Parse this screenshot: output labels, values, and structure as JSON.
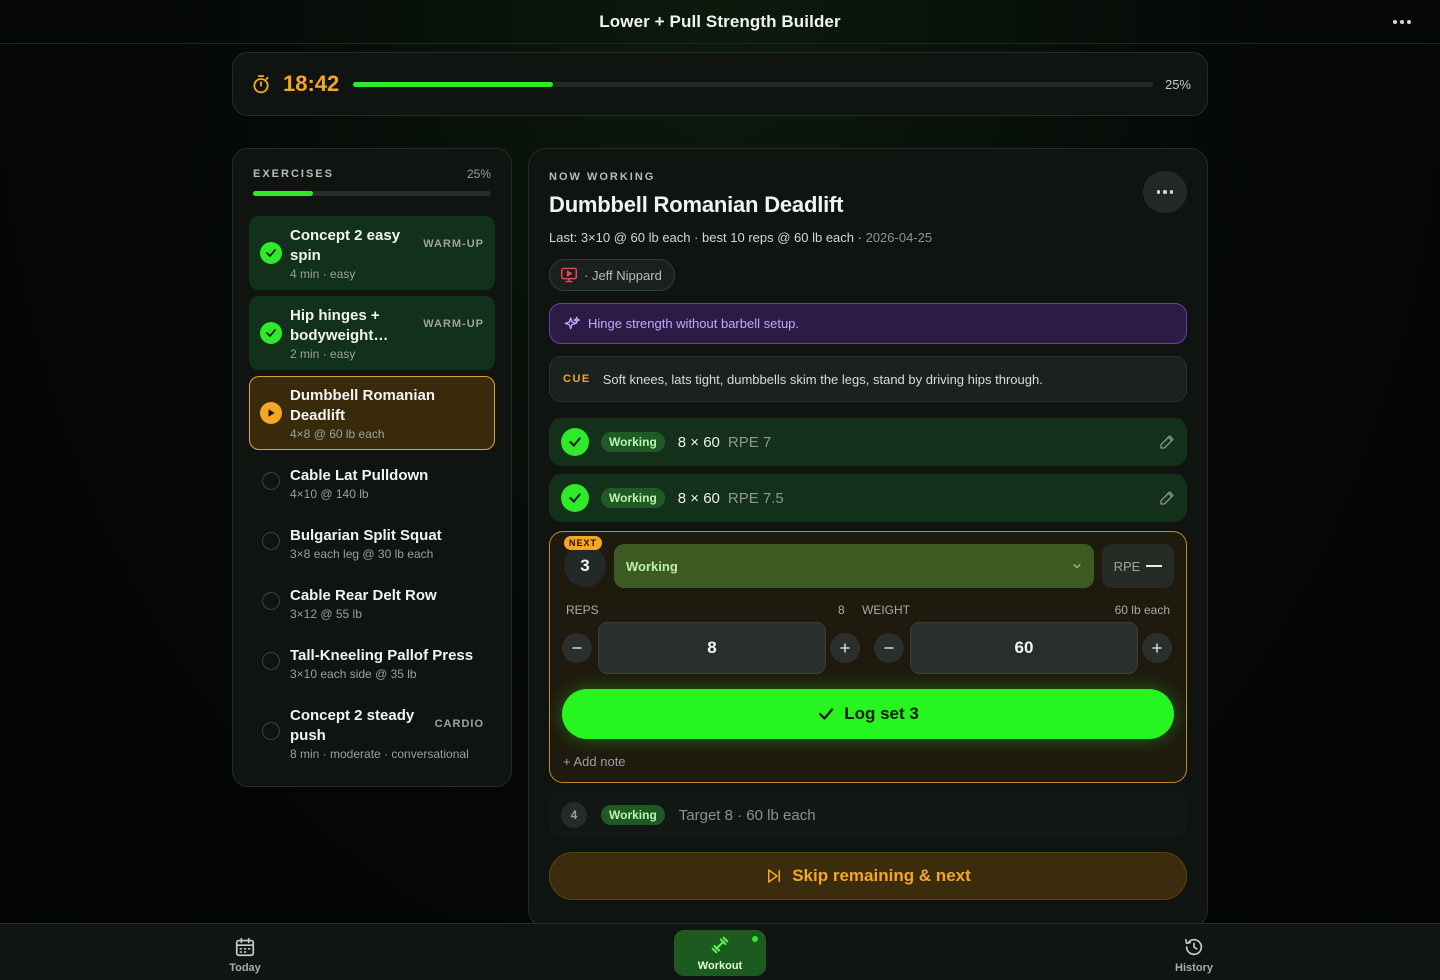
{
  "app": {
    "title": "Lower + Pull Strength Builder"
  },
  "timer": {
    "elapsed": "18:42",
    "progress_label": "25%",
    "progress": 0.25
  },
  "exercises": {
    "label": "EXERCISES",
    "progress_label": "25%",
    "progress": 0.25,
    "items": [
      {
        "name": "Concept 2 easy spin",
        "meta": "4 min · easy",
        "tag": "WARM-UP",
        "status": "done"
      },
      {
        "name": "Hip hinges + bodyweight…",
        "meta": "2 min · easy",
        "tag": "WARM-UP",
        "status": "done"
      },
      {
        "name": "Dumbbell Romanian Deadlift",
        "meta": "4×8 @ 60 lb each",
        "tag": "",
        "status": "active"
      },
      {
        "name": "Cable Lat Pulldown",
        "meta": "4×10 @ 140 lb",
        "tag": "",
        "status": "todo"
      },
      {
        "name": "Bulgarian Split Squat",
        "meta": "3×8 each leg @ 30 lb each",
        "tag": "",
        "status": "todo"
      },
      {
        "name": "Cable Rear Delt Row",
        "meta": "3×12 @ 55 lb",
        "tag": "",
        "status": "todo"
      },
      {
        "name": "Tall-Kneeling Pallof Press",
        "meta": "3×10 each side @ 35 lb",
        "tag": "",
        "status": "todo"
      },
      {
        "name": "Concept 2 steady push",
        "meta": "8 min · moderate · conversational",
        "tag": "CARDIO",
        "status": "todo"
      }
    ]
  },
  "current": {
    "section_label": "NOW WORKING",
    "title": "Dumbbell Romanian Deadlift",
    "last_prefix": "Last:",
    "last_detail": "3×10 @ 60 lb each · best 10 reps @ 60 lb each ·",
    "last_date": "2026-04-25",
    "creator": "· Jeff Nippard",
    "purpose": "Hinge strength without barbell setup.",
    "cue_label": "CUE",
    "cue": "Soft knees, lats tight, dumbbells skim the legs, stand by driving hips through."
  },
  "sets": {
    "completed": [
      {
        "type": "Working",
        "value": "8 × 60",
        "rpe": "RPE 7"
      },
      {
        "type": "Working",
        "value": "8 × 60",
        "rpe": "RPE 7.5"
      }
    ],
    "next": {
      "badge": "NEXT",
      "number": "3",
      "type": "Working",
      "rpe_label": "RPE",
      "reps_label": "REPS",
      "reps_hint": "8",
      "weight_label": "WEIGHT",
      "weight_hint": "60 lb each",
      "reps": "8",
      "weight": "60",
      "log_label": "Log set 3",
      "add_note": "+ Add note"
    },
    "upcoming": [
      {
        "number": "4",
        "type": "Working",
        "target": "Target 8 · 60 lb each"
      }
    ]
  },
  "skip_label": "Skip remaining & next",
  "nav": {
    "today": "Today",
    "workout": "Workout",
    "history": "History"
  },
  "colors": {
    "accent_green": "#2eea2a",
    "accent_amber": "#f5a623",
    "purple": "#c9a4ff"
  }
}
